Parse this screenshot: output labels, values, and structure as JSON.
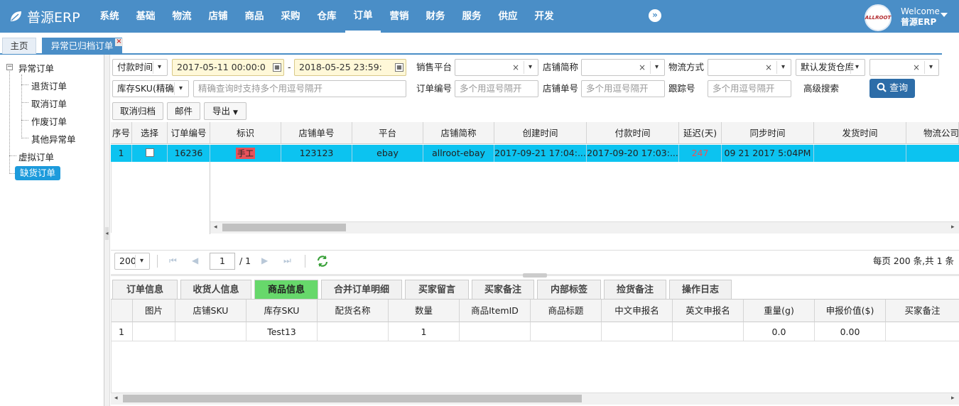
{
  "app": {
    "brand": "普源ERP"
  },
  "nav": [
    "系统",
    "基础",
    "物流",
    "店铺",
    "商品",
    "采购",
    "仓库",
    "订单",
    "营销",
    "财务",
    "服务",
    "供应",
    "开发"
  ],
  "nav_active": "订单",
  "user": {
    "welcome": "Welcome",
    "name": "普源ERP",
    "avatar_text": "ALLROOT"
  },
  "tabs": {
    "home": "主页",
    "current": "异常已归档订单",
    "close": "×"
  },
  "tree": {
    "root": "异常订单",
    "children": [
      "退货订单",
      "取消订单",
      "作废订单",
      "其他异常单"
    ],
    "siblings": [
      "虚拟订单",
      "缺货订单"
    ],
    "selected": "缺货订单"
  },
  "filters": {
    "time_type": "付款时间",
    "date_from": "2017-05-11 00:00:0",
    "date_sep": "-",
    "date_to": "2018-05-25 23:59:",
    "platform_label": "销售平台",
    "shop_label": "店铺简称",
    "logistics_label": "物流方式",
    "warehouse": "默认发货仓库",
    "sku_type": "库存SKU(精确",
    "sku_placeholder": "精确查询时支持多个用逗号隔开",
    "order_no_label": "订单编号",
    "order_no_placeholder": "多个用逗号隔开",
    "shop_no_label": "店铺单号",
    "shop_no_placeholder": "多个用逗号隔开",
    "tracking_label": "跟踪号",
    "tracking_placeholder": "多个用逗号隔开",
    "advanced": "高级搜索",
    "search": "查询",
    "clear": "×",
    "caret": "▾"
  },
  "actions": {
    "unarchive": "取消归档",
    "mail": "邮件",
    "export": "导出"
  },
  "grid": {
    "columns": [
      "序号",
      "选择",
      "订单编号",
      "标识",
      "店铺单号",
      "平台",
      "店铺简称",
      "创建时间",
      "付款时间",
      "延迟(天)",
      "同步时间",
      "发货时间",
      "物流公司"
    ],
    "rows": [
      {
        "seq": "1",
        "order_no": "16236",
        "tag": "手工",
        "shop_no": "123123",
        "platform": "ebay",
        "shop": "allroot-ebay",
        "created": "2017-09-21 17:04:...",
        "paid": "2017-09-20 17:03:...",
        "delay": "247",
        "synced": "09 21 2017 5:04PM",
        "shipped": "",
        "carrier": ""
      }
    ]
  },
  "pager": {
    "size": "200",
    "page": "1",
    "total_pages": "/ 1",
    "info": "每页 200 条,共 1 条"
  },
  "detail_tabs": [
    "订单信息",
    "收货人信息",
    "商品信息",
    "合并订单明细",
    "买家留言",
    "买家备注",
    "内部标签",
    "捡货备注",
    "操作日志"
  ],
  "detail_active": "商品信息",
  "detail": {
    "columns": [
      "图片",
      "店铺SKU",
      "库存SKU",
      "配货名称",
      "数量",
      "商品ItemID",
      "商品标题",
      "中文申报名",
      "英文申报名",
      "重量(g)",
      "申报价值($)",
      "买家备注"
    ],
    "rows": [
      {
        "seq": "1",
        "image": "",
        "shop_sku": "",
        "sku": "Test13",
        "alloc": "",
        "qty": "1",
        "item_id": "",
        "title": "",
        "cn": "",
        "en": "",
        "weight": "0.0",
        "value": "0.00",
        "note": ""
      }
    ]
  },
  "colors": {
    "header": "#4a8ec7",
    "selected_row": "#0cc3f0",
    "tag_bg": "#e8525a",
    "active_tab": "#67d86b",
    "search_btn": "#2d6da8"
  }
}
